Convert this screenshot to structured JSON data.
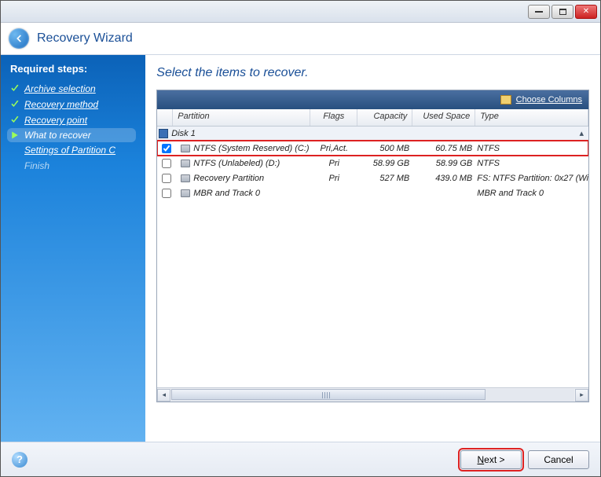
{
  "window": {
    "title": "Recovery Wizard"
  },
  "sidebar": {
    "header": "Required steps:",
    "steps": [
      {
        "label": "Archive selection",
        "done": true
      },
      {
        "label": "Recovery method",
        "done": true
      },
      {
        "label": "Recovery point",
        "done": true
      }
    ],
    "current": "What to recover",
    "next": "Settings of Partition C",
    "finish": "Finish"
  },
  "content": {
    "title": "Select the items to recover.",
    "choose_columns": "Choose Columns"
  },
  "columns": {
    "partition": "Partition",
    "flags": "Flags",
    "capacity": "Capacity",
    "used": "Used Space",
    "type": "Type"
  },
  "disk": {
    "label": "Disk 1"
  },
  "rows": [
    {
      "checked": true,
      "name": "NTFS (System Reserved) (C:)",
      "flags": "Pri,Act.",
      "capacity": "500 MB",
      "used": "60.75 MB",
      "type": "NTFS",
      "highlight": true
    },
    {
      "checked": false,
      "name": "NTFS (Unlabeled) (D:)",
      "flags": "Pri",
      "capacity": "58.99 GB",
      "used": "58.99 GB",
      "type": "NTFS"
    },
    {
      "checked": false,
      "name": "Recovery Partition",
      "flags": "Pri",
      "capacity": "527 MB",
      "used": "439.0 MB",
      "type": "FS: NTFS Partition: 0x27 (Wi"
    },
    {
      "checked": false,
      "name": "MBR and Track 0",
      "flags": "",
      "capacity": "",
      "used": "",
      "type": "MBR and Track 0"
    }
  ],
  "footer": {
    "next": "Next >",
    "cancel": "Cancel"
  }
}
